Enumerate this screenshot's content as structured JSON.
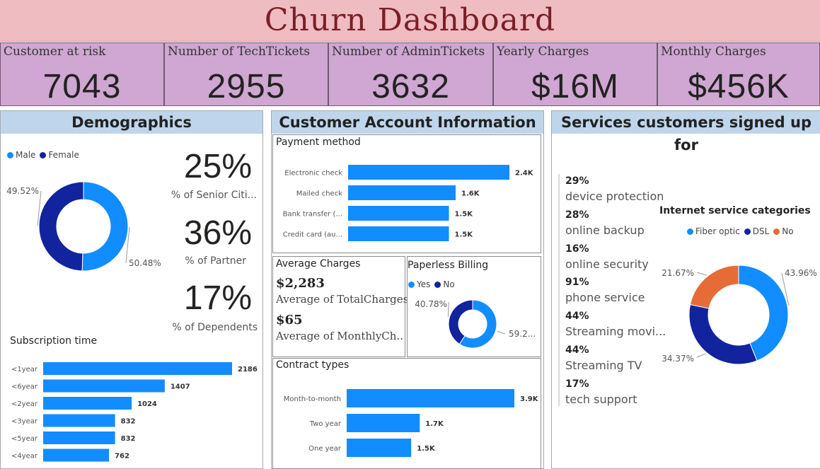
{
  "title": "Churn Dashboard",
  "kpis": [
    {
      "label": "Customer at risk",
      "value": "7043"
    },
    {
      "label": "Number of TechTickets",
      "value": "2955"
    },
    {
      "label": "Number of AdminTickets",
      "value": "3632"
    },
    {
      "label": "Yearly Charges",
      "value": "$16M"
    },
    {
      "label": "Monthly Charges",
      "value": "$456K"
    }
  ],
  "demographics": {
    "title": "Demographics",
    "legend": [
      {
        "label": "Male",
        "color": "#118dff"
      },
      {
        "label": "Female",
        "color": "#12239e"
      }
    ],
    "senior": {
      "value": "25%",
      "caption": "% of Senior Citi..."
    },
    "partner": {
      "value": "36%",
      "caption": "% of Partner"
    },
    "dependents": {
      "value": "17%",
      "caption": "% of Dependents"
    },
    "subscription_title": "Subscription time"
  },
  "account": {
    "title": "Customer Account Information",
    "payment_title": "Payment method",
    "average_title": "Average Charges",
    "avg_total_value": "$2,283",
    "avg_total_caption": "Average of TotalCharges",
    "avg_monthly_value": "$65",
    "avg_monthly_caption": "Average of MonthlyCh...",
    "paperless_title": "Paperless Billing",
    "paperless_legend": [
      {
        "label": "Yes",
        "color": "#118dff"
      },
      {
        "label": "No",
        "color": "#12239e"
      }
    ],
    "contract_title": "Contract types"
  },
  "services": {
    "title": "Services customers signed up for",
    "items": [
      {
        "pct": "29%",
        "label": "device protection"
      },
      {
        "pct": "28%",
        "label": "online backup"
      },
      {
        "pct": "16%",
        "label": "online security"
      },
      {
        "pct": "91%",
        "label": "phone service"
      },
      {
        "pct": "44%",
        "label": "Streaming movi..."
      },
      {
        "pct": "44%",
        "label": "Streaming TV"
      },
      {
        "pct": "17%",
        "label": "tech support"
      }
    ],
    "internet_title": "Internet service categories",
    "internet_legend": [
      {
        "label": "Fiber optic",
        "color": "#118dff"
      },
      {
        "label": "DSL",
        "color": "#12239e"
      },
      {
        "label": "No",
        "color": "#e66c37"
      }
    ]
  },
  "chart_data": [
    {
      "id": "gender",
      "type": "pie",
      "donut": true,
      "categories": [
        "Male",
        "Female"
      ],
      "values": [
        50.48,
        49.52
      ],
      "value_labels": [
        "50.48%",
        "49.52%"
      ],
      "colors": [
        "#118dff",
        "#12239e"
      ]
    },
    {
      "id": "subscription",
      "type": "bar",
      "orientation": "horizontal",
      "title": "Subscription time",
      "categories": [
        "<1year",
        "<6year",
        "<2year",
        "<3year",
        "<5year",
        "<4year"
      ],
      "values": [
        2186,
        1407,
        1024,
        832,
        832,
        762
      ],
      "value_labels": [
        "2186",
        "1407",
        "1024",
        "832",
        "832",
        "762"
      ],
      "xlim": [
        0,
        2186
      ],
      "color": "#118dff"
    },
    {
      "id": "payment",
      "type": "bar",
      "orientation": "horizontal",
      "title": "Payment method",
      "categories": [
        "Electronic check",
        "Mailed check",
        "Bank transfer (...",
        "Credit card (au..."
      ],
      "values": [
        2400,
        1600,
        1500,
        1500
      ],
      "value_labels": [
        "2.4K",
        "1.6K",
        "1.5K",
        "1.5K"
      ],
      "xlim": [
        0,
        2400
      ],
      "color": "#118dff"
    },
    {
      "id": "paperless",
      "type": "pie",
      "donut": true,
      "title": "Paperless Billing",
      "categories": [
        "Yes",
        "No"
      ],
      "values": [
        59.22,
        40.78
      ],
      "value_labels": [
        "59.2...",
        "40.78%"
      ],
      "colors": [
        "#118dff",
        "#12239e"
      ]
    },
    {
      "id": "contract",
      "type": "bar",
      "orientation": "horizontal",
      "title": "Contract types",
      "categories": [
        "Month-to-month",
        "Two year",
        "One year"
      ],
      "values": [
        3900,
        1700,
        1500
      ],
      "value_labels": [
        "3.9K",
        "1.7K",
        "1.5K"
      ],
      "xlim": [
        0,
        3900
      ],
      "color": "#118dff"
    },
    {
      "id": "internet",
      "type": "pie",
      "donut": true,
      "title": "Internet service categories",
      "categories": [
        "Fiber optic",
        "DSL",
        "No"
      ],
      "values": [
        43.96,
        34.37,
        21.67
      ],
      "value_labels": [
        "43.96%",
        "34.37%",
        "21.67%"
      ],
      "colors": [
        "#118dff",
        "#12239e",
        "#e66c37"
      ]
    }
  ]
}
